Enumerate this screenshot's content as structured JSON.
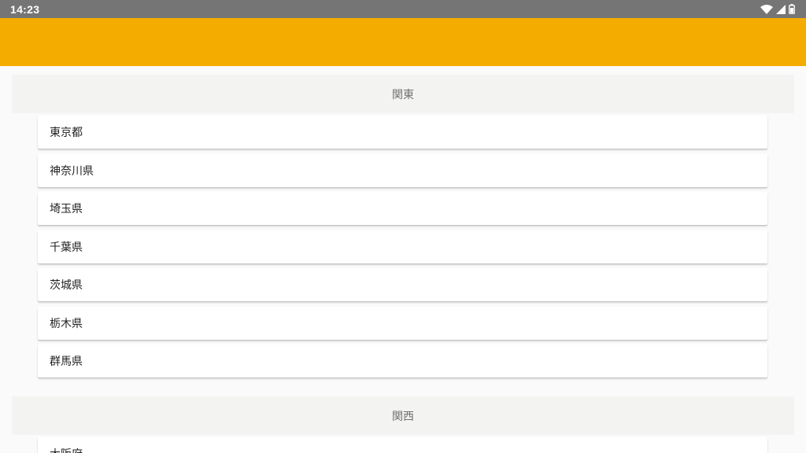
{
  "status_bar": {
    "time": "14:23",
    "icons": [
      "wifi-icon",
      "signal-icon",
      "battery-icon"
    ]
  },
  "app_bar": {
    "color": "#f5ac00"
  },
  "sections": [
    {
      "header": "関東",
      "items": [
        "東京都",
        "神奈川県",
        "埼玉県",
        "千葉県",
        "茨城県",
        "栃木県",
        "群馬県"
      ]
    },
    {
      "header": "関西",
      "items": [
        "大阪府"
      ]
    }
  ]
}
